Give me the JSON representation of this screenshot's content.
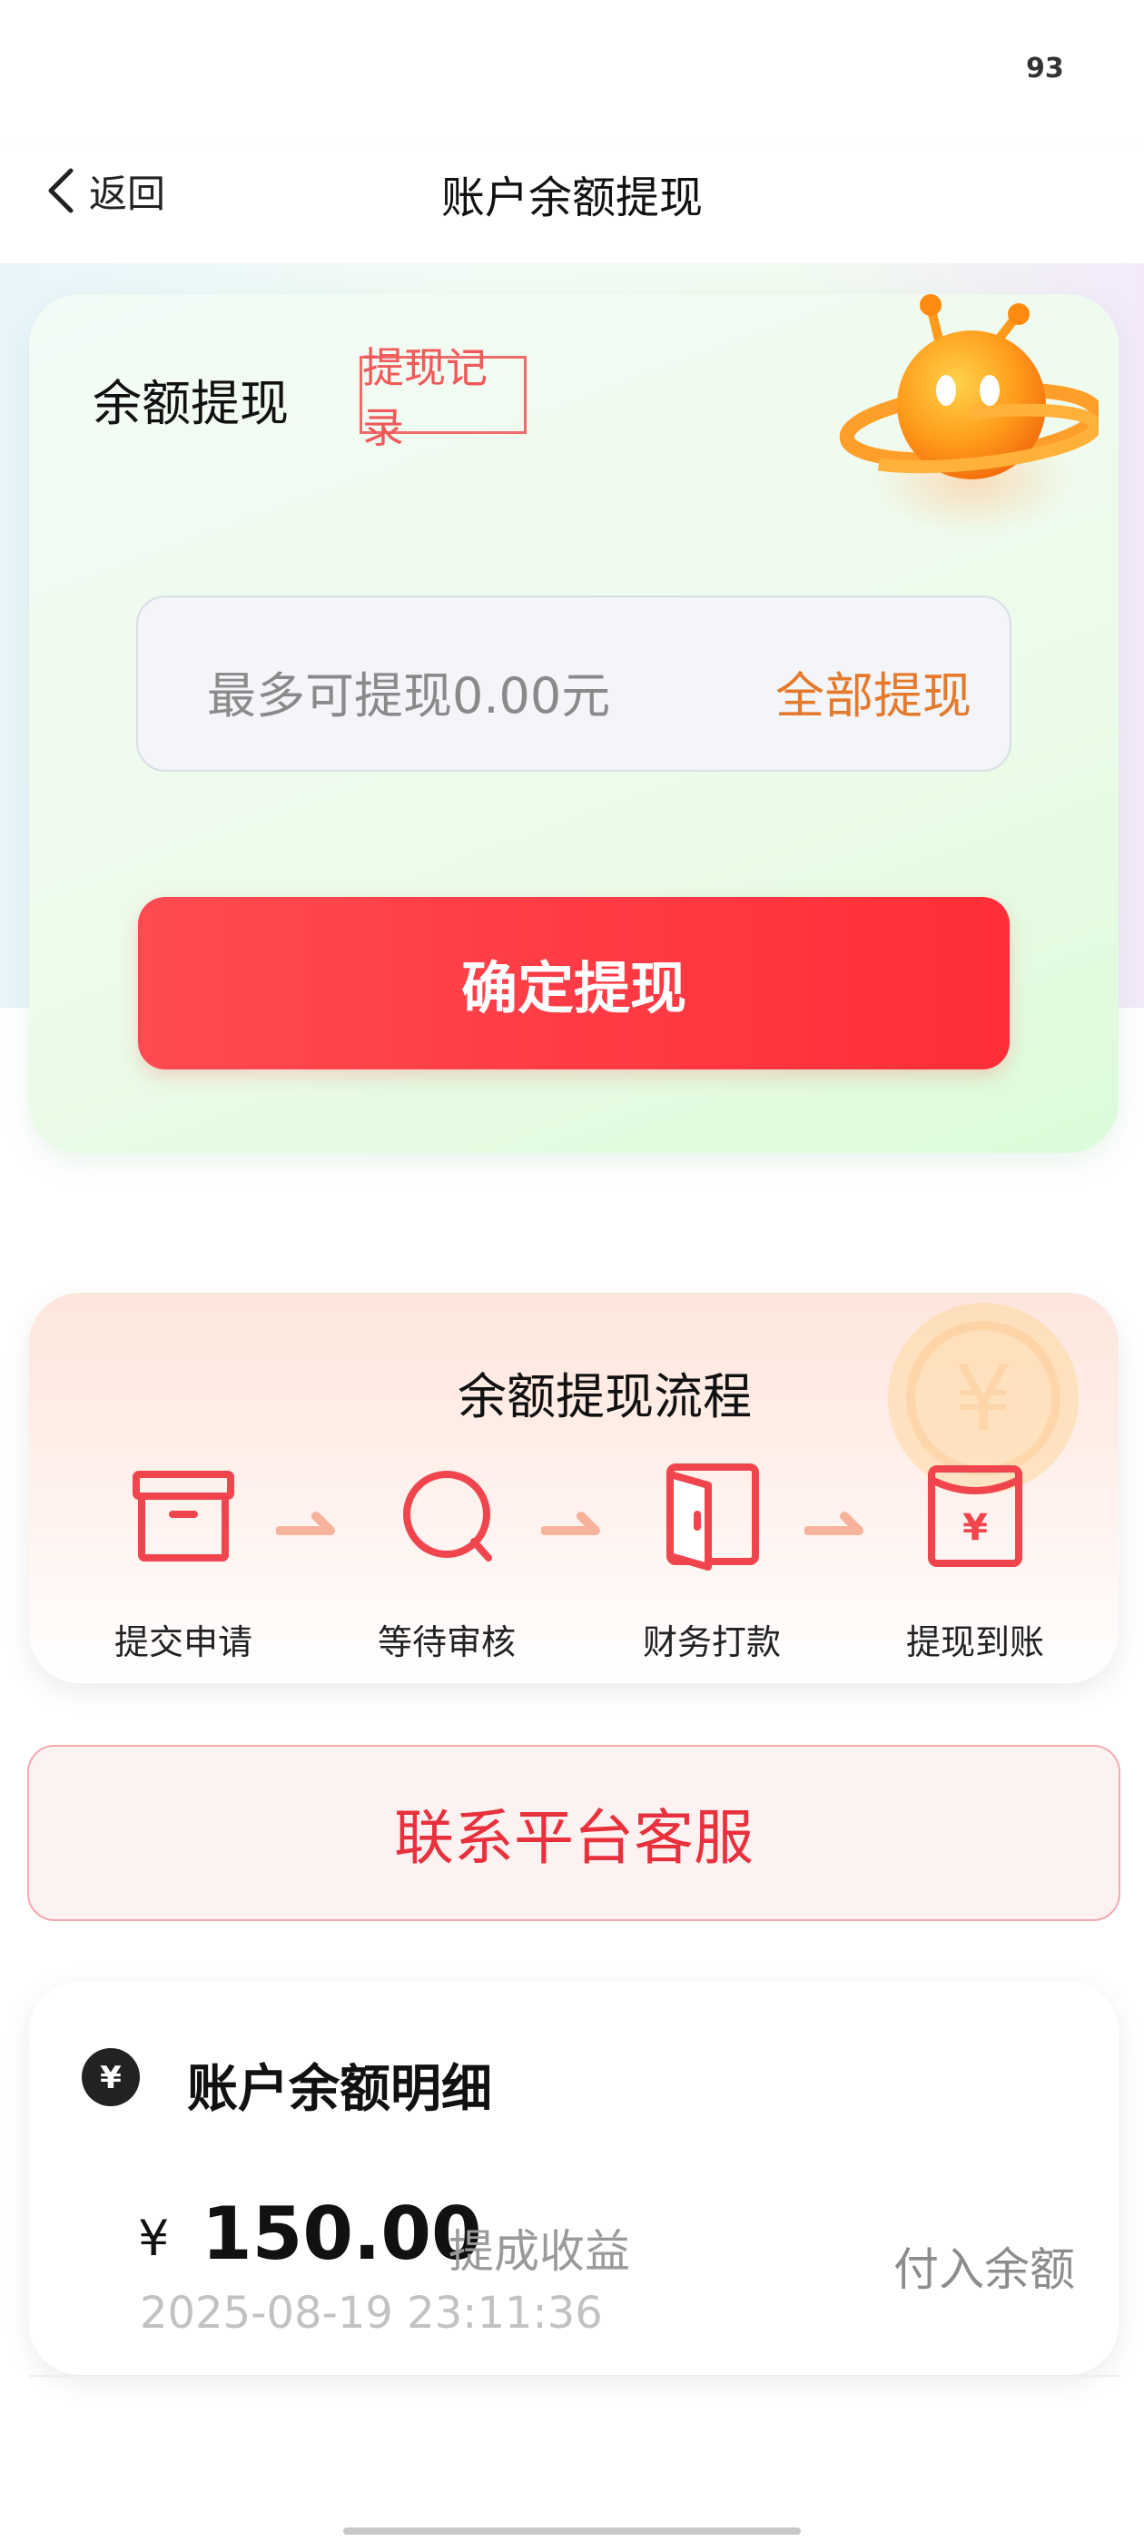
{
  "status_bar": {
    "battery": "93"
  },
  "header": {
    "back_label": "返回",
    "title": "账户余额提现"
  },
  "withdraw": {
    "title": "余额提现",
    "records_label": "提现记录",
    "amount_placeholder": "最多可提现0.00元",
    "all_label": "全部提现",
    "confirm_label": "确定提现"
  },
  "process": {
    "title": "余额提现流程",
    "steps": [
      {
        "label": "提交申请",
        "icon": "archive-box-icon"
      },
      {
        "label": "等待审核",
        "icon": "search-icon"
      },
      {
        "label": "财务打款",
        "icon": "door-icon"
      },
      {
        "label": "提现到账",
        "icon": "yen-envelope-icon"
      }
    ]
  },
  "contact": {
    "label": "联系平台客服"
  },
  "detail": {
    "title": "账户余额明细",
    "currency_symbol": "¥",
    "items": [
      {
        "amount": "150.00",
        "desc": "提成收益",
        "time": "2025-08-19 23:11:36",
        "status": "付入余额"
      }
    ]
  },
  "colors": {
    "accent_red": "#ff3a42",
    "accent_orange": "#e5792c",
    "icon_red": "#f0454d"
  }
}
